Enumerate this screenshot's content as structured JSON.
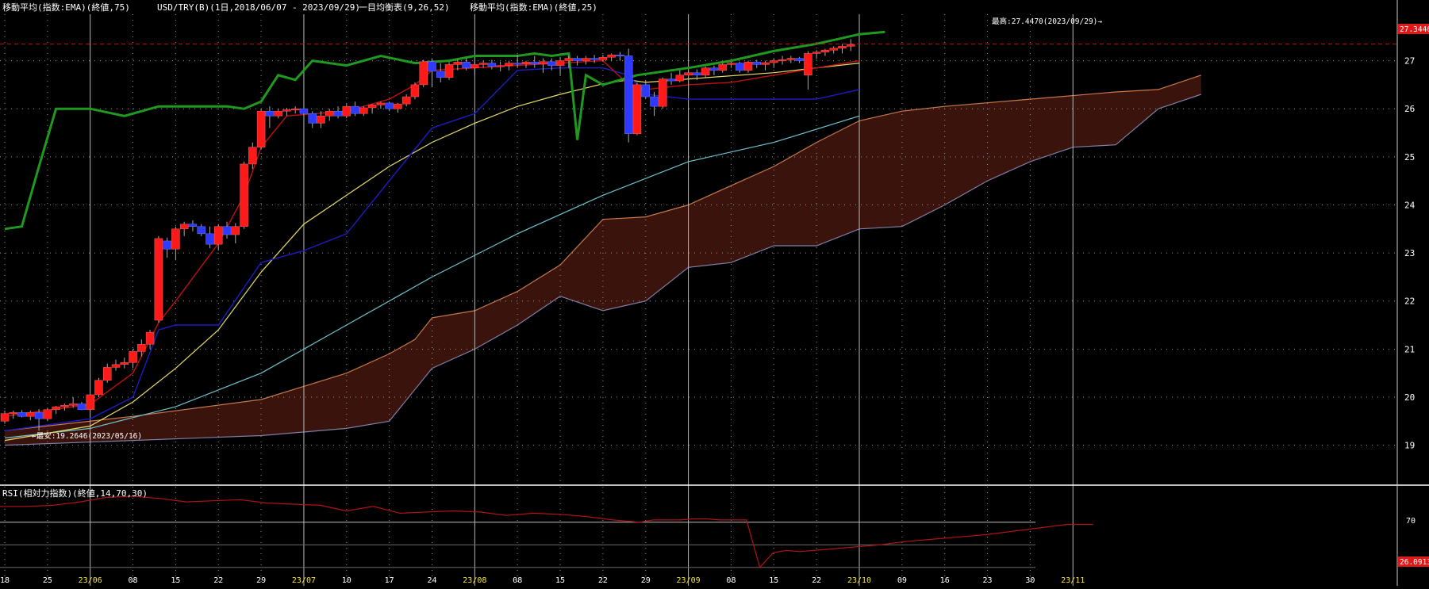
{
  "header": {
    "ema75": "移動平均(指数:EMA)(終値,75)",
    "pair": "USD/TRY(B)(1日,2018/06/07 - 2023/09/29)",
    "ichimoku": "一目均衡表(9,26,52)",
    "ema25": "移動平均(指数:EMA)(終値,25)"
  },
  "colors": {
    "background": "#000000",
    "up": "#ff1a1a",
    "down": "#2e3bff",
    "grid": "#9a9a9a",
    "ema25": "#e8dc6a",
    "ema75": "#6fc4cf",
    "tenkan": "#c01010",
    "kijun": "#1c1cc8",
    "chikou": "#1f9a1f",
    "cloud": "#3a140c",
    "spanA": "#c8784a",
    "spanB": "#7f7fa8",
    "rsi": "#b01414",
    "high_line": "#c01515"
  },
  "annotations": {
    "high": "最高:27.4470(2023/09/29)→",
    "low": "←最安:19.2646(2023/05/16)",
    "last_price": "27.3446",
    "rsi_value": "26.0913"
  },
  "rsi_panel": {
    "title": "RSI(相対力指数)(終値,14,70,30)",
    "level_label": "70"
  },
  "chart_data": {
    "type": "candlestick",
    "title": "USD/TRY(B)(1日,2018/06/07 - 2023/09/29)",
    "price_ylim": [
      18.4,
      27.9
    ],
    "yticks": [
      19,
      20,
      21,
      22,
      23,
      24,
      25,
      26,
      27
    ],
    "high": 27.447,
    "high_date": "2023/09/29",
    "low": 19.2646,
    "low_date": "2023/05/16",
    "last_price": 27.3446,
    "x_tick_labels": [
      "18",
      "25",
      "23/06",
      "08",
      "15",
      "22",
      "29",
      "23/07",
      "10",
      "17",
      "24",
      "23/08",
      "08",
      "15",
      "22",
      "29",
      "23/09",
      "08",
      "15",
      "22",
      "23/10",
      "09",
      "16",
      "23",
      "30",
      "23/11"
    ],
    "x_tick_index": [
      0,
      5,
      10,
      15,
      20,
      25,
      30,
      35,
      40,
      45,
      50,
      55,
      60,
      65,
      70,
      75,
      80,
      85,
      90,
      95,
      100,
      105,
      110,
      115,
      120,
      125
    ],
    "month_markers_index": [
      10,
      35,
      55,
      80,
      100,
      125
    ],
    "candles": [
      [
        19.5,
        19.72,
        19.45,
        19.66
      ],
      [
        19.66,
        19.72,
        19.55,
        19.68
      ],
      [
        19.68,
        19.73,
        19.58,
        19.6
      ],
      [
        19.6,
        19.72,
        19.52,
        19.68
      ],
      [
        19.68,
        19.75,
        19.3,
        19.55
      ],
      [
        19.55,
        19.78,
        19.5,
        19.74
      ],
      [
        19.74,
        19.82,
        19.65,
        19.8
      ],
      [
        19.8,
        19.87,
        19.72,
        19.83
      ],
      [
        19.83,
        20.0,
        19.78,
        19.86
      ],
      [
        19.86,
        19.9,
        19.73,
        19.74
      ],
      [
        19.74,
        20.05,
        19.7,
        20.05
      ],
      [
        20.05,
        20.4,
        20.0,
        20.35
      ],
      [
        20.35,
        20.7,
        20.3,
        20.62
      ],
      [
        20.62,
        20.78,
        20.55,
        20.68
      ],
      [
        20.68,
        20.82,
        20.6,
        20.72
      ],
      [
        20.72,
        21.0,
        20.6,
        20.95
      ],
      [
        20.95,
        21.2,
        20.85,
        21.1
      ],
      [
        21.1,
        21.4,
        21.0,
        21.35
      ],
      [
        21.6,
        23.35,
        21.55,
        23.3
      ],
      [
        23.25,
        23.32,
        22.9,
        23.08
      ],
      [
        23.08,
        23.55,
        22.85,
        23.5
      ],
      [
        23.5,
        23.65,
        23.35,
        23.6
      ],
      [
        23.6,
        23.68,
        23.45,
        23.55
      ],
      [
        23.55,
        23.6,
        23.35,
        23.4
      ],
      [
        23.4,
        23.55,
        23.1,
        23.18
      ],
      [
        23.18,
        23.6,
        23.05,
        23.55
      ],
      [
        23.55,
        23.65,
        23.3,
        23.38
      ],
      [
        23.38,
        23.62,
        23.2,
        23.55
      ],
      [
        23.55,
        24.9,
        23.5,
        24.85
      ],
      [
        24.85,
        25.3,
        24.75,
        25.2
      ],
      [
        25.2,
        26.0,
        25.15,
        25.95
      ],
      [
        25.95,
        26.05,
        25.6,
        25.85
      ],
      [
        25.85,
        26.0,
        25.8,
        25.95
      ],
      [
        25.95,
        26.02,
        25.85,
        25.98
      ],
      [
        25.98,
        26.05,
        25.9,
        26.0
      ],
      [
        26.0,
        26.05,
        25.85,
        25.9
      ],
      [
        25.9,
        25.95,
        25.6,
        25.7
      ],
      [
        25.7,
        25.95,
        25.6,
        25.85
      ],
      [
        25.85,
        26.0,
        25.75,
        25.95
      ],
      [
        25.95,
        26.05,
        25.8,
        25.85
      ],
      [
        25.85,
        26.1,
        25.8,
        26.05
      ],
      [
        26.05,
        26.15,
        25.85,
        25.9
      ],
      [
        25.9,
        26.05,
        25.85,
        26.02
      ],
      [
        26.02,
        26.1,
        25.9,
        26.08
      ],
      [
        26.08,
        26.15,
        26.0,
        26.12
      ],
      [
        26.12,
        26.15,
        25.95,
        26.0
      ],
      [
        26.0,
        26.12,
        25.92,
        26.1
      ],
      [
        26.1,
        26.3,
        26.05,
        26.25
      ],
      [
        26.25,
        26.55,
        26.2,
        26.5
      ],
      [
        26.5,
        27.02,
        26.45,
        26.98
      ],
      [
        26.98,
        27.05,
        26.45,
        26.78
      ],
      [
        26.78,
        26.95,
        26.55,
        26.65
      ],
      [
        26.65,
        26.97,
        26.6,
        26.92
      ],
      [
        26.92,
        27.02,
        26.8,
        26.97
      ],
      [
        26.97,
        27.05,
        26.8,
        26.85
      ],
      [
        26.85,
        26.98,
        26.7,
        26.92
      ],
      [
        26.92,
        27.0,
        26.85,
        26.95
      ],
      [
        26.95,
        27.02,
        26.82,
        26.88
      ],
      [
        26.88,
        26.98,
        26.78,
        26.9
      ],
      [
        26.9,
        27.0,
        26.8,
        26.95
      ],
      [
        26.95,
        27.12,
        26.85,
        26.93
      ],
      [
        26.93,
        27.0,
        26.85,
        26.97
      ],
      [
        26.97,
        27.1,
        26.85,
        26.93
      ],
      [
        26.93,
        27.05,
        26.75,
        26.98
      ],
      [
        26.98,
        27.05,
        26.8,
        26.9
      ],
      [
        26.9,
        27.08,
        26.7,
        27.0
      ],
      [
        27.0,
        27.1,
        26.85,
        27.05
      ],
      [
        27.05,
        27.1,
        26.9,
        27.0
      ],
      [
        27.0,
        27.1,
        26.92,
        27.05
      ],
      [
        27.05,
        27.12,
        26.95,
        27.02
      ],
      [
        27.02,
        27.12,
        26.98,
        27.07
      ],
      [
        27.07,
        27.15,
        27.0,
        27.12
      ],
      [
        27.12,
        27.18,
        27.0,
        27.1
      ],
      [
        27.1,
        27.25,
        25.3,
        25.48
      ],
      [
        25.48,
        26.55,
        25.45,
        26.5
      ],
      [
        26.5,
        26.6,
        26.2,
        26.25
      ],
      [
        26.25,
        26.35,
        25.85,
        26.05
      ],
      [
        26.05,
        26.65,
        26.0,
        26.62
      ],
      [
        26.62,
        26.75,
        26.5,
        26.58
      ],
      [
        26.58,
        26.8,
        26.55,
        26.7
      ],
      [
        26.7,
        26.8,
        26.3,
        26.75
      ],
      [
        26.75,
        26.82,
        26.6,
        26.7
      ],
      [
        26.7,
        26.88,
        26.65,
        26.85
      ],
      [
        26.85,
        26.9,
        26.7,
        26.8
      ],
      [
        26.8,
        26.95,
        26.75,
        26.92
      ],
      [
        26.92,
        26.98,
        26.85,
        26.95
      ],
      [
        26.95,
        26.98,
        26.75,
        26.8
      ],
      [
        26.8,
        27.0,
        26.75,
        26.97
      ],
      [
        26.97,
        27.02,
        26.85,
        26.92
      ],
      [
        26.92,
        27.0,
        26.8,
        26.96
      ],
      [
        26.96,
        27.05,
        26.85,
        27.0
      ],
      [
        27.0,
        27.1,
        26.92,
        27.02
      ],
      [
        27.02,
        27.1,
        26.95,
        27.05
      ],
      [
        27.05,
        27.08,
        26.95,
        27.0
      ],
      [
        26.7,
        27.2,
        26.4,
        27.15
      ],
      [
        27.15,
        27.22,
        27.05,
        27.18
      ],
      [
        27.18,
        27.25,
        27.1,
        27.22
      ],
      [
        27.22,
        27.3,
        27.15,
        27.26
      ],
      [
        27.26,
        27.35,
        27.15,
        27.3
      ],
      [
        27.3,
        27.45,
        27.2,
        27.34
      ]
    ],
    "ema25": [
      [
        0,
        19.1
      ],
      [
        10,
        19.4
      ],
      [
        15,
        19.9
      ],
      [
        20,
        20.6
      ],
      [
        25,
        21.4
      ],
      [
        30,
        22.6
      ],
      [
        35,
        23.6
      ],
      [
        40,
        24.2
      ],
      [
        45,
        24.8
      ],
      [
        50,
        25.3
      ],
      [
        55,
        25.7
      ],
      [
        60,
        26.05
      ],
      [
        65,
        26.3
      ],
      [
        70,
        26.52
      ],
      [
        73,
        26.6
      ],
      [
        75,
        26.55
      ],
      [
        80,
        26.62
      ],
      [
        90,
        26.75
      ],
      [
        100,
        26.95
      ]
    ],
    "ema75": [
      [
        0,
        19.15
      ],
      [
        10,
        19.35
      ],
      [
        20,
        19.8
      ],
      [
        30,
        20.5
      ],
      [
        40,
        21.5
      ],
      [
        50,
        22.5
      ],
      [
        60,
        23.4
      ],
      [
        70,
        24.2
      ],
      [
        80,
        24.9
      ],
      [
        90,
        25.3
      ],
      [
        100,
        25.85
      ]
    ],
    "tenkan": [
      [
        0,
        19.6
      ],
      [
        10,
        19.85
      ],
      [
        15,
        20.5
      ],
      [
        18,
        21.55
      ],
      [
        20,
        22.0
      ],
      [
        25,
        23.2
      ],
      [
        28,
        24.2
      ],
      [
        30,
        25.2
      ],
      [
        33,
        25.85
      ],
      [
        40,
        25.95
      ],
      [
        45,
        26.2
      ],
      [
        48,
        26.5
      ],
      [
        50,
        26.8
      ],
      [
        60,
        26.9
      ],
      [
        70,
        27.0
      ],
      [
        73,
        26.5
      ],
      [
        75,
        26.4
      ],
      [
        80,
        26.5
      ],
      [
        85,
        26.55
      ],
      [
        90,
        26.7
      ],
      [
        95,
        26.85
      ],
      [
        100,
        27.0
      ]
    ],
    "kijun": [
      [
        0,
        19.3
      ],
      [
        10,
        19.55
      ],
      [
        15,
        20.0
      ],
      [
        18,
        21.4
      ],
      [
        20,
        21.5
      ],
      [
        25,
        21.5
      ],
      [
        30,
        22.8
      ],
      [
        35,
        23.05
      ],
      [
        40,
        23.4
      ],
      [
        45,
        24.5
      ],
      [
        50,
        25.6
      ],
      [
        55,
        25.9
      ],
      [
        60,
        26.8
      ],
      [
        65,
        26.85
      ],
      [
        70,
        26.85
      ],
      [
        73,
        26.7
      ],
      [
        75,
        26.3
      ],
      [
        80,
        26.2
      ],
      [
        85,
        26.2
      ],
      [
        90,
        26.2
      ],
      [
        95,
        26.2
      ],
      [
        100,
        26.4
      ]
    ],
    "chikou": [
      [
        0,
        23.5
      ],
      [
        2,
        23.55
      ],
      [
        4,
        24.8
      ],
      [
        6,
        26.0
      ],
      [
        10,
        26.0
      ],
      [
        14,
        25.85
      ],
      [
        18,
        26.05
      ],
      [
        22,
        26.05
      ],
      [
        26,
        26.05
      ],
      [
        28,
        26.0
      ],
      [
        30,
        26.15
      ],
      [
        32,
        26.7
      ],
      [
        34,
        26.6
      ],
      [
        36,
        27.0
      ],
      [
        40,
        26.9
      ],
      [
        44,
        27.1
      ],
      [
        48,
        26.95
      ],
      [
        52,
        27.0
      ],
      [
        55,
        27.1
      ],
      [
        60,
        27.1
      ],
      [
        62,
        27.15
      ],
      [
        64,
        27.1
      ],
      [
        66,
        27.15
      ],
      [
        67,
        25.35
      ],
      [
        68,
        26.7
      ],
      [
        70,
        26.5
      ],
      [
        74,
        26.7
      ],
      [
        80,
        26.85
      ],
      [
        85,
        27.0
      ],
      [
        90,
        27.2
      ],
      [
        95,
        27.35
      ],
      [
        100,
        27.55
      ],
      [
        103,
        27.6
      ]
    ],
    "span_a": [
      [
        0,
        19.3
      ],
      [
        15,
        19.6
      ],
      [
        30,
        19.95
      ],
      [
        40,
        20.5
      ],
      [
        45,
        20.9
      ],
      [
        48,
        21.2
      ],
      [
        50,
        21.65
      ],
      [
        55,
        21.8
      ],
      [
        60,
        22.2
      ],
      [
        65,
        22.75
      ],
      [
        70,
        23.7
      ],
      [
        75,
        23.75
      ],
      [
        80,
        24.0
      ],
      [
        85,
        24.4
      ],
      [
        90,
        24.8
      ],
      [
        95,
        25.3
      ],
      [
        100,
        25.75
      ],
      [
        105,
        25.95
      ],
      [
        110,
        26.05
      ],
      [
        120,
        26.2
      ],
      [
        130,
        26.35
      ],
      [
        135,
        26.4
      ],
      [
        140,
        26.7
      ]
    ],
    "span_b": [
      [
        0,
        19.0
      ],
      [
        15,
        19.1
      ],
      [
        30,
        19.2
      ],
      [
        40,
        19.35
      ],
      [
        45,
        19.5
      ],
      [
        50,
        20.6
      ],
      [
        55,
        21.0
      ],
      [
        60,
        21.5
      ],
      [
        65,
        22.1
      ],
      [
        70,
        21.8
      ],
      [
        75,
        22.0
      ],
      [
        80,
        22.7
      ],
      [
        85,
        22.8
      ],
      [
        90,
        23.15
      ],
      [
        95,
        23.15
      ],
      [
        100,
        23.5
      ],
      [
        105,
        23.55
      ],
      [
        110,
        24.0
      ],
      [
        115,
        24.5
      ],
      [
        120,
        24.9
      ],
      [
        125,
        25.2
      ],
      [
        130,
        25.25
      ],
      [
        135,
        26.0
      ],
      [
        140,
        26.3
      ]
    ],
    "rsi_ylim": [
      20,
      100
    ],
    "rsi_levels": [
      70,
      50,
      30
    ],
    "rsi": [
      [
        0,
        84
      ],
      [
        4,
        84
      ],
      [
        8,
        85
      ],
      [
        12,
        88
      ],
      [
        16,
        92
      ],
      [
        20,
        93
      ],
      [
        24,
        91
      ],
      [
        28,
        88
      ],
      [
        32,
        89
      ],
      [
        36,
        90
      ],
      [
        40,
        87
      ],
      [
        44,
        86
      ],
      [
        48,
        85
      ],
      [
        52,
        80
      ],
      [
        56,
        84
      ],
      [
        60,
        78
      ],
      [
        64,
        79
      ],
      [
        68,
        80
      ],
      [
        72,
        79
      ],
      [
        76,
        76
      ],
      [
        80,
        78
      ],
      [
        84,
        77
      ],
      [
        88,
        75
      ],
      [
        92,
        72
      ],
      [
        96,
        70
      ],
      [
        98,
        72
      ],
      [
        102,
        72
      ],
      [
        104,
        73
      ],
      [
        106,
        73
      ],
      [
        108,
        72
      ],
      [
        110,
        72
      ],
      [
        112,
        72
      ],
      [
        114,
        30
      ],
      [
        116,
        43
      ],
      [
        118,
        45
      ],
      [
        120,
        44
      ],
      [
        124,
        46
      ],
      [
        128,
        48
      ],
      [
        132,
        50
      ],
      [
        136,
        53
      ],
      [
        140,
        55
      ],
      [
        144,
        57
      ],
      [
        148,
        59
      ],
      [
        152,
        62
      ],
      [
        156,
        65
      ],
      [
        160,
        68
      ],
      [
        164,
        68
      ]
    ],
    "rsi_last": 26.0913,
    "rsi_tick_label": "70"
  }
}
